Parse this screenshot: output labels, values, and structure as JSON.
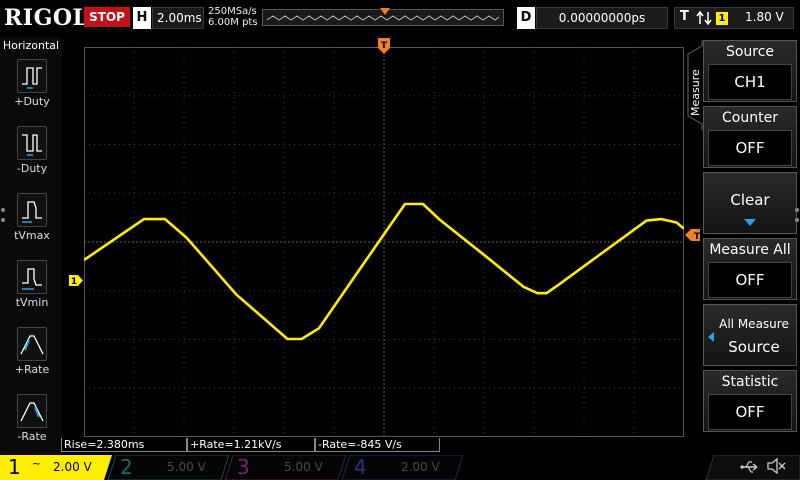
{
  "topbar": {
    "logo": "RIGOL",
    "run_state": "STOP",
    "timebase_key": "H",
    "timebase": "2.00ms",
    "sample_rate": "250MSa/s",
    "memory_depth": "6.00M pts",
    "delay_key": "D",
    "delay": "0.00000000ps",
    "trigger_key": "T",
    "trigger_source": "1",
    "trigger_level": "1.80 V"
  },
  "left_menu": {
    "title": "Horizontal",
    "items": [
      {
        "label": "+Duty",
        "icon": "positive-duty-icon"
      },
      {
        "label": "-Duty",
        "icon": "negative-duty-icon"
      },
      {
        "label": "tVmax",
        "icon": "time-at-vmax-icon"
      },
      {
        "label": "tVmin",
        "icon": "time-at-vmin-icon"
      },
      {
        "label": "+Rate",
        "icon": "positive-rate-icon"
      },
      {
        "label": "-Rate",
        "icon": "negative-rate-icon"
      }
    ]
  },
  "right_menu": {
    "title": "Measure",
    "keys": [
      {
        "name": "Source",
        "value": "CH1"
      },
      {
        "name": "Counter",
        "value": "OFF"
      },
      {
        "name": "Clear",
        "value": ""
      },
      {
        "name": "Measure All",
        "value": "OFF"
      },
      {
        "name": "All Measure",
        "value": "Source"
      },
      {
        "name": "Statistic",
        "value": "OFF"
      }
    ]
  },
  "measurements": [
    {
      "text": "Rise=2.380ms"
    },
    {
      "text": "+Rate=1.21kV/s"
    },
    {
      "text": "-Rate=-845 V/s"
    }
  ],
  "channels": [
    {
      "num": "1",
      "coupling": "~",
      "scale": "2.00 V",
      "color": "#ffff00",
      "active": true
    },
    {
      "num": "2",
      "coupling": "",
      "scale": "5.00 V",
      "color": "#00c0c0",
      "active": false
    },
    {
      "num": "3",
      "coupling": "",
      "scale": "5.00 V",
      "color": "#d000d0",
      "active": false
    },
    {
      "num": "4",
      "coupling": "",
      "scale": "2.00 V",
      "color": "#3050ff",
      "active": false
    }
  ],
  "waveform": {
    "channel": "1",
    "color": "#ffee00",
    "shape": "triangle",
    "points_divisions": [
      [
        0,
        4.37
      ],
      [
        1.2,
        3.53
      ],
      [
        1.62,
        3.53
      ],
      [
        2.05,
        3.91
      ],
      [
        3.05,
        5.08
      ],
      [
        4.07,
        5.99
      ],
      [
        4.35,
        5.99
      ],
      [
        4.7,
        5.77
      ],
      [
        5.5,
        4.58
      ],
      [
        6.42,
        3.22
      ],
      [
        6.78,
        3.22
      ],
      [
        7.1,
        3.53
      ],
      [
        8.02,
        4.28
      ],
      [
        8.79,
        4.92
      ],
      [
        9.07,
        5.05
      ],
      [
        9.25,
        5.05
      ],
      [
        9.5,
        4.87
      ],
      [
        11.25,
        3.56
      ],
      [
        11.55,
        3.53
      ],
      [
        11.85,
        3.6
      ],
      [
        12,
        3.73
      ]
    ]
  },
  "status_icons": {
    "usb": "usb-icon",
    "speaker": "speaker-muted-icon"
  }
}
